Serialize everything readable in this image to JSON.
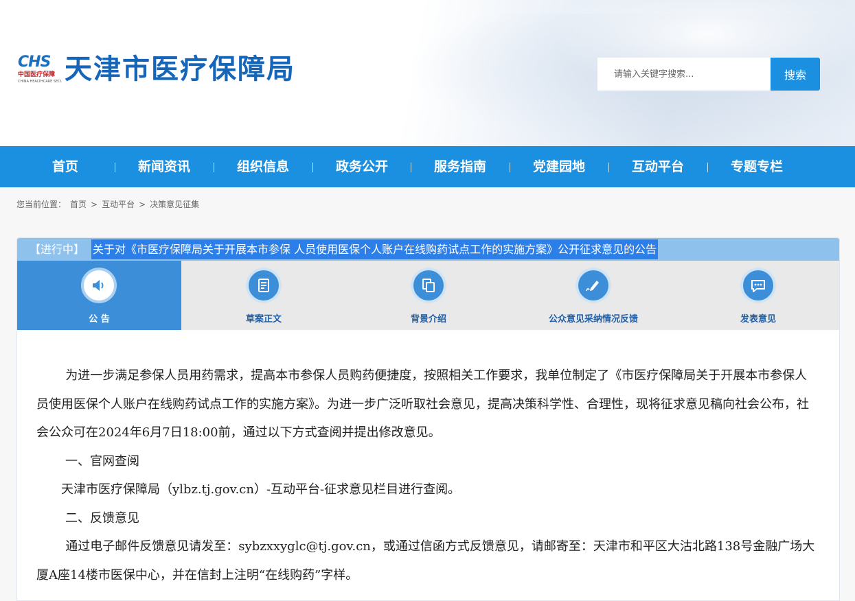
{
  "header": {
    "logo_mark": "CHS",
    "logo_subtitle": "中国医疗保障",
    "logo_english": "CHINA HEALTHCARE SECURITY",
    "site_title": "天津市医疗保障局",
    "search_placeholder": "请输入关键字搜索...",
    "search_button": "搜索"
  },
  "nav": {
    "items": [
      "首页",
      "新闻资讯",
      "组织信息",
      "政务公开",
      "服务指南",
      "党建园地",
      "互动平台",
      "专题专栏"
    ]
  },
  "breadcrumb": {
    "prefix": "您当前位置：",
    "items": [
      "首页",
      "互动平台",
      "决策意见征集"
    ],
    "separator": ">"
  },
  "notice": {
    "status": "【进行中】",
    "title": "关于对《市医疗保障局关于开展本市参保 人员使用医保个人账户在线购药试点工作的实施方案》公开征求意见的公告"
  },
  "tabs": [
    {
      "label": "公  告",
      "icon": "speaker-icon",
      "active": true
    },
    {
      "label": "草案正文",
      "icon": "document-icon",
      "active": false
    },
    {
      "label": "背景介绍",
      "icon": "copy-pages-icon",
      "active": false
    },
    {
      "label": "公众意见采纳情况反馈",
      "icon": "pen-sign-icon",
      "active": false
    },
    {
      "label": "发表意见",
      "icon": "chat-bubble-icon",
      "active": false
    }
  ],
  "content": {
    "para1": "为进一步满足参保人员用药需求，提高本市参保人员购药便捷度，按照相关工作要求，我单位制定了《市医疗保障局关于开展本市参保人员使用医保个人账户在线购药试点工作的实施方案》。为进一步广泛听取社会意见，提高决策科学性、合理性，现将征求意见稿向社会公布，社会公众可在2024年6月7日18:00前，通过以下方式查阅并提出修改意见。",
    "heading1": "一、官网查阅",
    "para2": "天津市医疗保障局（ylbz.tj.gov.cn）-互动平台-征求意见栏目进行查阅。",
    "heading2": "二、反馈意见",
    "para3": "通过电子邮件反馈意见请发至：sybzxxyglc@tj.gov.cn，或通过信函方式反馈意见，请邮寄至：天津市和平区大沽北路138号金融广场大厦A座14楼市医保中心，并在信封上注明“在线购药”字样。"
  },
  "colors": {
    "nav_bg": "#1b8fe0",
    "title_bar_bg": "#8ec2ec",
    "title_highlight": "#2c7ee8",
    "active_tab": "#3d8ed8",
    "site_title": "#1565b8"
  }
}
